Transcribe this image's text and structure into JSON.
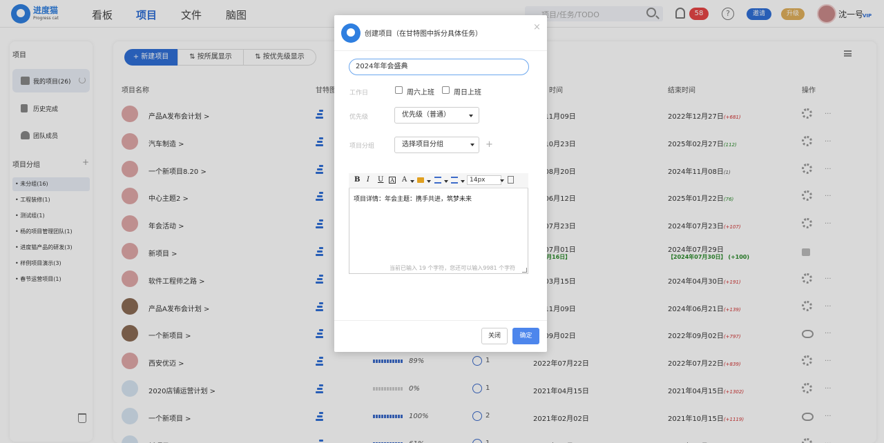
{
  "header": {
    "logo_text": "进度猫",
    "logo_sub": "Progress cat",
    "nav": [
      "看板",
      "项目",
      "文件",
      "脑图"
    ],
    "search_placeholder": "项目/任务/TODO",
    "notif_count": "58",
    "help": "?",
    "invite": "邀请",
    "upgrade": "升级",
    "username": "沈一号",
    "vip": "VIP"
  },
  "sidebar": {
    "title": "项目",
    "items": [
      "我的项目(26)",
      "历史完成",
      "团队成员"
    ],
    "group_title": "项目分组",
    "group_add": "+",
    "groups": [
      "• 未分组(16)",
      "• 工程装修(1)",
      "• 测试组(1)",
      "• 杨的项目管理团队(1)",
      "• 进度猫产品的研发(3)",
      "• 样例项目演示(3)",
      "• 春节运营项目(1)"
    ]
  },
  "toolbar": {
    "new": "+ 新建项目",
    "by_owner": "按所属显示",
    "by_priority": "按优先级显示"
  },
  "table": {
    "headers": [
      "项目名称",
      "甘特图",
      "时间",
      "结束时间",
      "操作"
    ],
    "rows": [
      {
        "name": "产品A发布会计划 >",
        "start": "2年11月09日",
        "start_note": "",
        "end": "2022年12月27日",
        "over": "(+681)",
        "end_note": "",
        "pct": "",
        "mem": ""
      },
      {
        "name": "汽车制造 >",
        "start": "4年10月23日",
        "start_note": "",
        "end": "2025年02月27日",
        "over": "(112)",
        "end_note": "",
        "pct": "",
        "mem": ""
      },
      {
        "name": "一个新项目8.20 >",
        "start": "4年08月20日",
        "start_note": "",
        "end": "2024年11月08日",
        "over": "(1)",
        "end_note": "",
        "pct": "",
        "mem": ""
      },
      {
        "name": "中心主题2 >",
        "start": "4年06月12日",
        "start_note": "",
        "end": "2025年01月22日",
        "over": "(76)",
        "end_note": "",
        "pct": "",
        "mem": ""
      },
      {
        "name": "年会活动 >",
        "start": "4年07月23日",
        "start_note": "",
        "end": "2024年07月23日",
        "over": "(+107)",
        "end_note": "",
        "pct": "",
        "mem": ""
      },
      {
        "name": "新项目 >",
        "start": "4年07月01日",
        "start_note": "4年7月16日】",
        "end": "2024年07月29日",
        "over": "",
        "end_note": "【2024年07月30日】 (+100)",
        "pct": "",
        "mem": ""
      },
      {
        "name": "软件工程师之路 >",
        "start": "4年03月15日",
        "start_note": "",
        "end": "2024年04月30日",
        "over": "(+191)",
        "end_note": "",
        "pct": "",
        "mem": ""
      },
      {
        "name": "产品A发布会计划 >",
        "start": "2年11月09日",
        "start_note": "",
        "end": "2024年06月21日",
        "over": "(+139)",
        "end_note": "",
        "pct": "",
        "mem": ""
      },
      {
        "name": "一个新项目 >",
        "start": "2年09月02日",
        "start_note": "",
        "end": "2022年09月02日",
        "over": "(+797)",
        "end_note": "",
        "pct": "",
        "mem": ""
      },
      {
        "name": "西安优迈 >",
        "start": "2022年07月22日",
        "start_note": "",
        "end": "2022年07月22日",
        "over": "(+839)",
        "end_note": "",
        "pct": "89%",
        "mem": "1"
      },
      {
        "name": "2020店铺运营计划 >",
        "start": "2021年04月15日",
        "start_note": "",
        "end": "2021年04月15日",
        "over": "(+1302)",
        "end_note": "",
        "pct": "0%",
        "mem": "1"
      },
      {
        "name": "一个新项目 >",
        "start": "2021年02月02日",
        "start_note": "",
        "end": "2021年10月15日",
        "over": "(+1119)",
        "end_note": "",
        "pct": "100%",
        "mem": "2"
      },
      {
        "name": "新项目 >",
        "start": "2020年11月13日",
        "start_note": "",
        "end": "2020年11月18日",
        "over": "(+1450)",
        "end_note": "",
        "pct": "61%",
        "mem": "1"
      }
    ],
    "more": "..."
  },
  "modal": {
    "title": "创建项目（在甘特图中拆分具体任务）",
    "close": "×",
    "name_value": "2024年年会盛典",
    "workday_label": "工作日",
    "sat": "周六上班",
    "sun": "周日上班",
    "priority_label": "优先级",
    "priority_value": "优先级（普通）",
    "group_label": "项目分组",
    "group_value": "选择项目分组",
    "group_add": "+",
    "editor": {
      "bold": "B",
      "italic": "I",
      "underline": "U",
      "box": "A",
      "color": "A",
      "font_size": "14px",
      "content": "项目详情：年会主题：携手共进，筑梦未来",
      "count": "当前已输入 19 个字符，您还可以输入9981 个字符"
    },
    "btn_close": "关闭",
    "btn_ok": "确定"
  }
}
